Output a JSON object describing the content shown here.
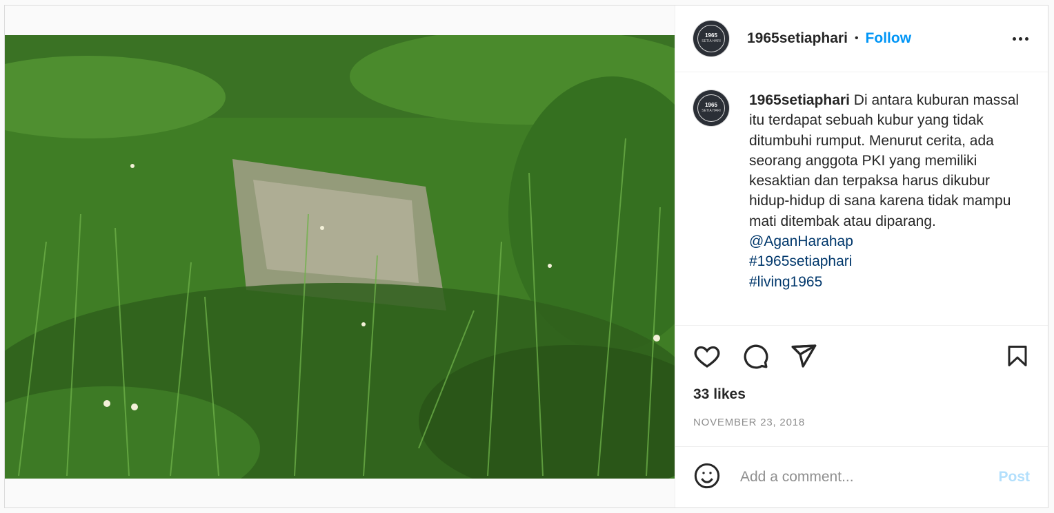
{
  "post": {
    "username": "1965setiaphari",
    "follow_label": "Follow",
    "dot": "•",
    "avatar": {
      "line1": "1965",
      "line2": "SETIA HARI"
    },
    "caption": {
      "username": "1965setiaphari",
      "text": "Di antara kuburan massal itu terdapat sebuah kubur yang tidak ditumbuhi rumput. Menurut cerita, ada seorang anggota PKI yang memiliki kesaktian dan terpaksa harus dikubur hidup-hidup di sana karena tidak mampu mati ditembak atau diparang.",
      "mention": "@AganHarahap",
      "hashtags": [
        "#1965setiaphari",
        "#living1965"
      ]
    },
    "likes": "33 likes",
    "date": "NOVEMBER 23, 2018",
    "comment": {
      "placeholder": "Add a comment...",
      "post_label": "Post"
    },
    "icons": {
      "like": "heart-icon",
      "comment": "comment-icon",
      "share": "share-icon",
      "save": "bookmark-icon",
      "emoji": "emoji-icon",
      "more": "more-options-icon"
    },
    "colors": {
      "accent": "#0095f6",
      "link": "#00376b",
      "post_disabled": "#b2dffc",
      "muted": "#8e8e8e"
    }
  }
}
